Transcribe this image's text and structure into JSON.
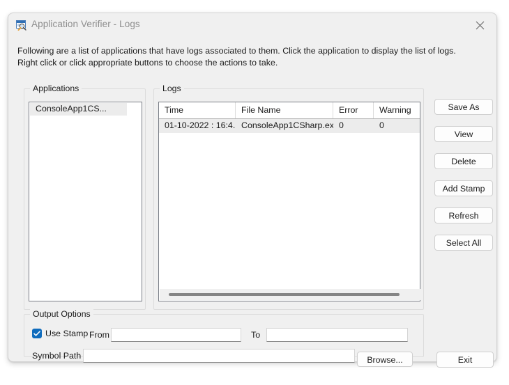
{
  "window": {
    "title": "Application Verifier - Logs",
    "icon": "app-verifier-icon",
    "close_icon": "close-icon"
  },
  "description": "Following are a list of applications that have logs associated to them. Click the application to display the list of logs. Right click or click appropriate buttons to choose the actions to take.",
  "applications": {
    "legend": "Applications",
    "items": [
      {
        "label": "ConsoleApp1CS..."
      }
    ]
  },
  "logs": {
    "legend": "Logs",
    "columns": [
      "Time",
      "File Name",
      "Error",
      "Warning"
    ],
    "rows": [
      {
        "time": "01-10-2022 : 16:4...",
        "file_name": "ConsoleApp1CSharp.ex...",
        "error": "0",
        "warning": "0"
      }
    ]
  },
  "buttons": {
    "save_as": "Save As",
    "view": "View",
    "delete": "Delete",
    "add_stamp": "Add Stamp",
    "refresh": "Refresh",
    "select_all": "Select All",
    "browse": "Browse...",
    "exit": "Exit"
  },
  "output_options": {
    "legend": "Output Options",
    "use_stamp_label": "Use Stamp",
    "use_stamp_checked": true,
    "from_label": "From",
    "from_value": "",
    "to_label": "To",
    "to_value": "",
    "symbol_path_label": "Symbol Path",
    "symbol_path_value": ""
  },
  "colors": {
    "accent": "#0f6cbd",
    "window_bg": "#f0f0f0",
    "field_bg": "#ffffff",
    "selection": "#ececec",
    "title_text": "#8d8d8d"
  }
}
